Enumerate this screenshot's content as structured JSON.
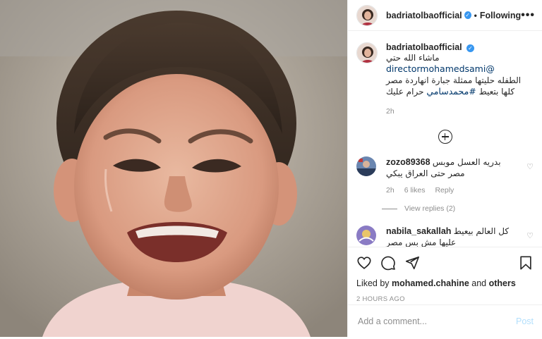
{
  "post": {
    "username": "badriatolbaofficial",
    "following_label": "Following",
    "more_label": "•••"
  },
  "caption": {
    "username": "badriatolbaofficial",
    "text_prefix": "ماشاء الله حتي",
    "mention": "@directormohamedsami",
    "line2": "الطفله حليتها ممثلة جبارة انهاردة مصر",
    "line3_text": "كلها بتعيط",
    "hashtag": "#محمدسامي",
    "line3_suffix": "حرام عليك",
    "time": "2h"
  },
  "comments": [
    {
      "username": "zozo89368",
      "line1": "بدريه العسل موبس",
      "line2": "مصر حتى العراق يبكي",
      "time": "2h",
      "likes": "6 likes",
      "reply": "Reply",
      "view_replies": "View replies (2)"
    },
    {
      "username": "nabila_sakallah",
      "line1": "كل العالم بيعيط",
      "line2": "عليها مش بس مصر"
    }
  ],
  "likes": {
    "prefix": "Liked by",
    "user": "mohamed.chahine",
    "and": "and",
    "others": "others"
  },
  "age": "2 HOURS AGO",
  "add_comment": {
    "placeholder": "Add a comment...",
    "post_label": "Post"
  },
  "icons": {
    "like": "heart-icon",
    "comment": "comment-icon",
    "share": "paper-plane-icon",
    "save": "bookmark-icon",
    "load_more": "plus-circle-icon"
  },
  "colors": {
    "verified": "#3897f0",
    "link": "#00376b",
    "muted": "#8e8e8e",
    "post_button": "#b2dffc"
  }
}
